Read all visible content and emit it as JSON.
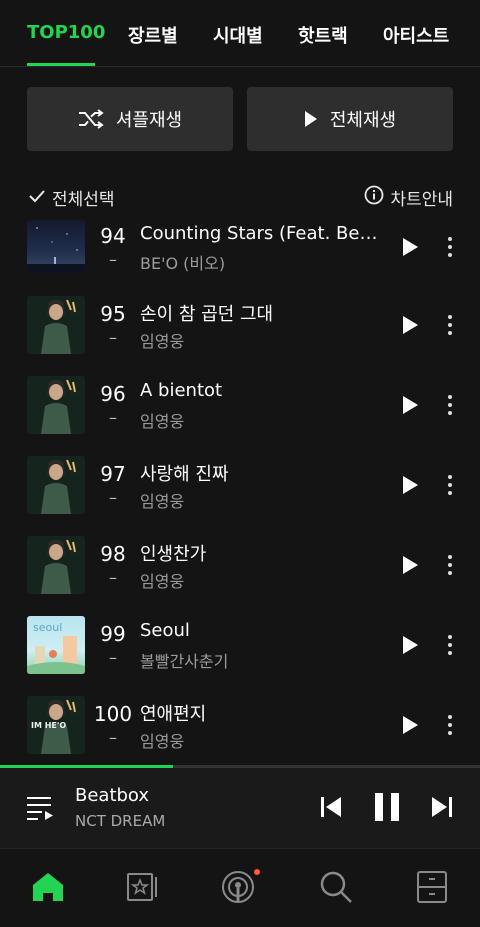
{
  "tabs": [
    {
      "label": "TOP100",
      "active": true
    },
    {
      "label": "장르별",
      "active": false
    },
    {
      "label": "시대별",
      "active": false
    },
    {
      "label": "핫트랙",
      "active": false
    },
    {
      "label": "아티스트",
      "active": false
    }
  ],
  "actions": {
    "shuffle_label": "셔플재생",
    "play_all_label": "전체재생"
  },
  "list_header": {
    "select_all_label": "전체선택",
    "chart_info_label": "차트안내"
  },
  "songs": [
    {
      "rank": "94",
      "change": "–",
      "title": "Counting Stars (Feat. Beenzino)",
      "artist": "BE'O (비오)"
    },
    {
      "rank": "95",
      "change": "–",
      "title": "손이 참 곱던 그대",
      "artist": "임영웅"
    },
    {
      "rank": "96",
      "change": "–",
      "title": "A bientot",
      "artist": "임영웅"
    },
    {
      "rank": "97",
      "change": "–",
      "title": "사랑해 진짜",
      "artist": "임영웅"
    },
    {
      "rank": "98",
      "change": "–",
      "title": "인생찬가",
      "artist": "임영웅"
    },
    {
      "rank": "99",
      "change": "–",
      "title": "Seoul",
      "artist": "볼빨간사춘기"
    },
    {
      "rank": "100",
      "change": "–",
      "title": "연애편지",
      "artist": "임영웅"
    }
  ],
  "album_text": {
    "im_hero": "IM HE'O",
    "seoul": "seoul"
  },
  "now_playing": {
    "title": "Beatbox",
    "artist": "NCT DREAM",
    "progress": 0.36
  },
  "bottom_nav": [
    {
      "icon": "home-icon",
      "active": true
    },
    {
      "icon": "library-icon",
      "active": false
    },
    {
      "icon": "podcast-icon",
      "active": false,
      "badge": true
    },
    {
      "icon": "search-icon",
      "active": false
    },
    {
      "icon": "storage-icon",
      "active": false
    }
  ],
  "colors": {
    "accent": "#22d454",
    "background": "#141414",
    "button": "#2e2e2e",
    "badge": "#ff5a3c"
  }
}
